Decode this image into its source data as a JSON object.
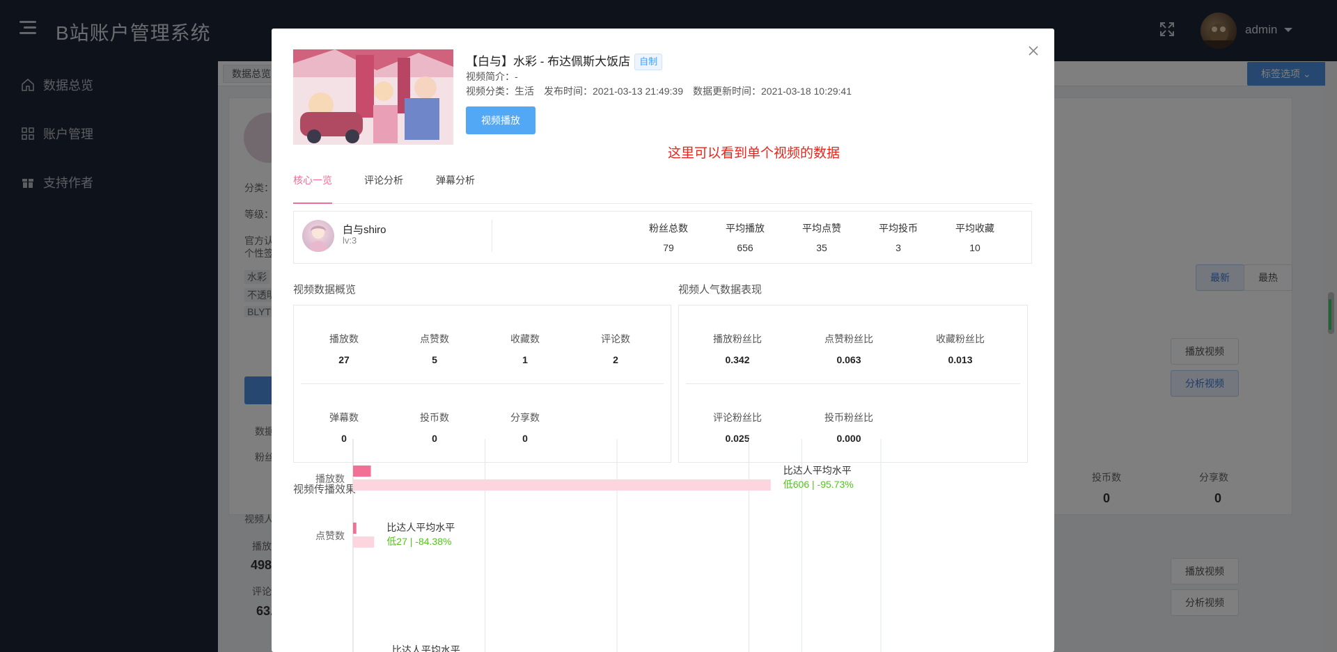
{
  "app": {
    "title": "B站账户管理系统",
    "user": "admin"
  },
  "sidebar": {
    "items": [
      {
        "label": "数据总览",
        "icon": "home-icon"
      },
      {
        "label": "账户管理",
        "icon": "grid-icon"
      },
      {
        "label": "支持作者",
        "icon": "gift-icon"
      }
    ]
  },
  "background": {
    "tab": "数据总览",
    "tag_options": "标签选项",
    "sort": {
      "latest": "最新",
      "hottest": "最热"
    },
    "buttons": {
      "play": "播放视频",
      "analyze": "分析视频"
    },
    "coin_label": "投币数",
    "share_label": "分享数",
    "coin_value": "0",
    "share_value": "0",
    "left_labels": [
      "分类：",
      "等级：",
      "官方认",
      "个性签",
      "水彩",
      "不透明",
      "BLYT",
      "数据",
      "粉丝",
      "视频人",
      "播放",
      "评论"
    ],
    "left_values": [
      "4987",
      "63."
    ]
  },
  "modal": {
    "title": "【白与】水彩 - 布达佩斯大饭店",
    "tag": "自制",
    "intro": "视频简介：-",
    "category": "视频分类：生活",
    "publish": "发布时间：2021-03-13 21:49:39",
    "updated": "数据更新时间：2021-03-18 10:29:41",
    "play_button": "视频播放",
    "note": "这里可以看到单个视频的数据",
    "tabs": [
      "核心一览",
      "评论分析",
      "弹幕分析"
    ],
    "author": {
      "name": "白与shiro",
      "level": "lv:3",
      "stats": [
        {
          "label": "粉丝总数",
          "value": "79"
        },
        {
          "label": "平均播放",
          "value": "656"
        },
        {
          "label": "平均点赞",
          "value": "35"
        },
        {
          "label": "平均投币",
          "value": "3"
        },
        {
          "label": "平均收藏",
          "value": "10"
        }
      ]
    },
    "overview": {
      "title": "视频数据概览",
      "cells": [
        {
          "label": "播放数",
          "value": "27"
        },
        {
          "label": "点赞数",
          "value": "5"
        },
        {
          "label": "收藏数",
          "value": "1"
        },
        {
          "label": "评论数",
          "value": "2"
        },
        {
          "label": "弹幕数",
          "value": "0"
        },
        {
          "label": "投币数",
          "value": "0"
        },
        {
          "label": "分享数",
          "value": "0"
        }
      ]
    },
    "popularity": {
      "title": "视频人气数据表现",
      "cells": [
        {
          "label": "播放粉丝比",
          "value": "0.342"
        },
        {
          "label": "点赞粉丝比",
          "value": "0.063"
        },
        {
          "label": "收藏粉丝比",
          "value": "0.013"
        },
        {
          "label": "评论粉丝比",
          "value": "0.025"
        },
        {
          "label": "投币粉丝比",
          "value": "0.000"
        }
      ]
    },
    "spread_title": "视频传播效果"
  },
  "chart_data": {
    "type": "bar",
    "orientation": "horizontal",
    "categories": [
      "播放数",
      "点赞数"
    ],
    "series": [
      {
        "values": [
          27,
          5
        ],
        "color": "#f07096"
      },
      {
        "values": [
          633,
          32
        ],
        "color": "#fcd5df"
      }
    ],
    "annotations": [
      {
        "category": "播放数",
        "title": "比达人平均水平",
        "text": "低606 | -95.73%"
      },
      {
        "category": "点赞数",
        "title": "比达人平均水平",
        "text": "低27 | -84.38%"
      }
    ],
    "partial_annotation": "比达人平均水平",
    "xlim": [
      0,
      800
    ],
    "grid": true
  }
}
